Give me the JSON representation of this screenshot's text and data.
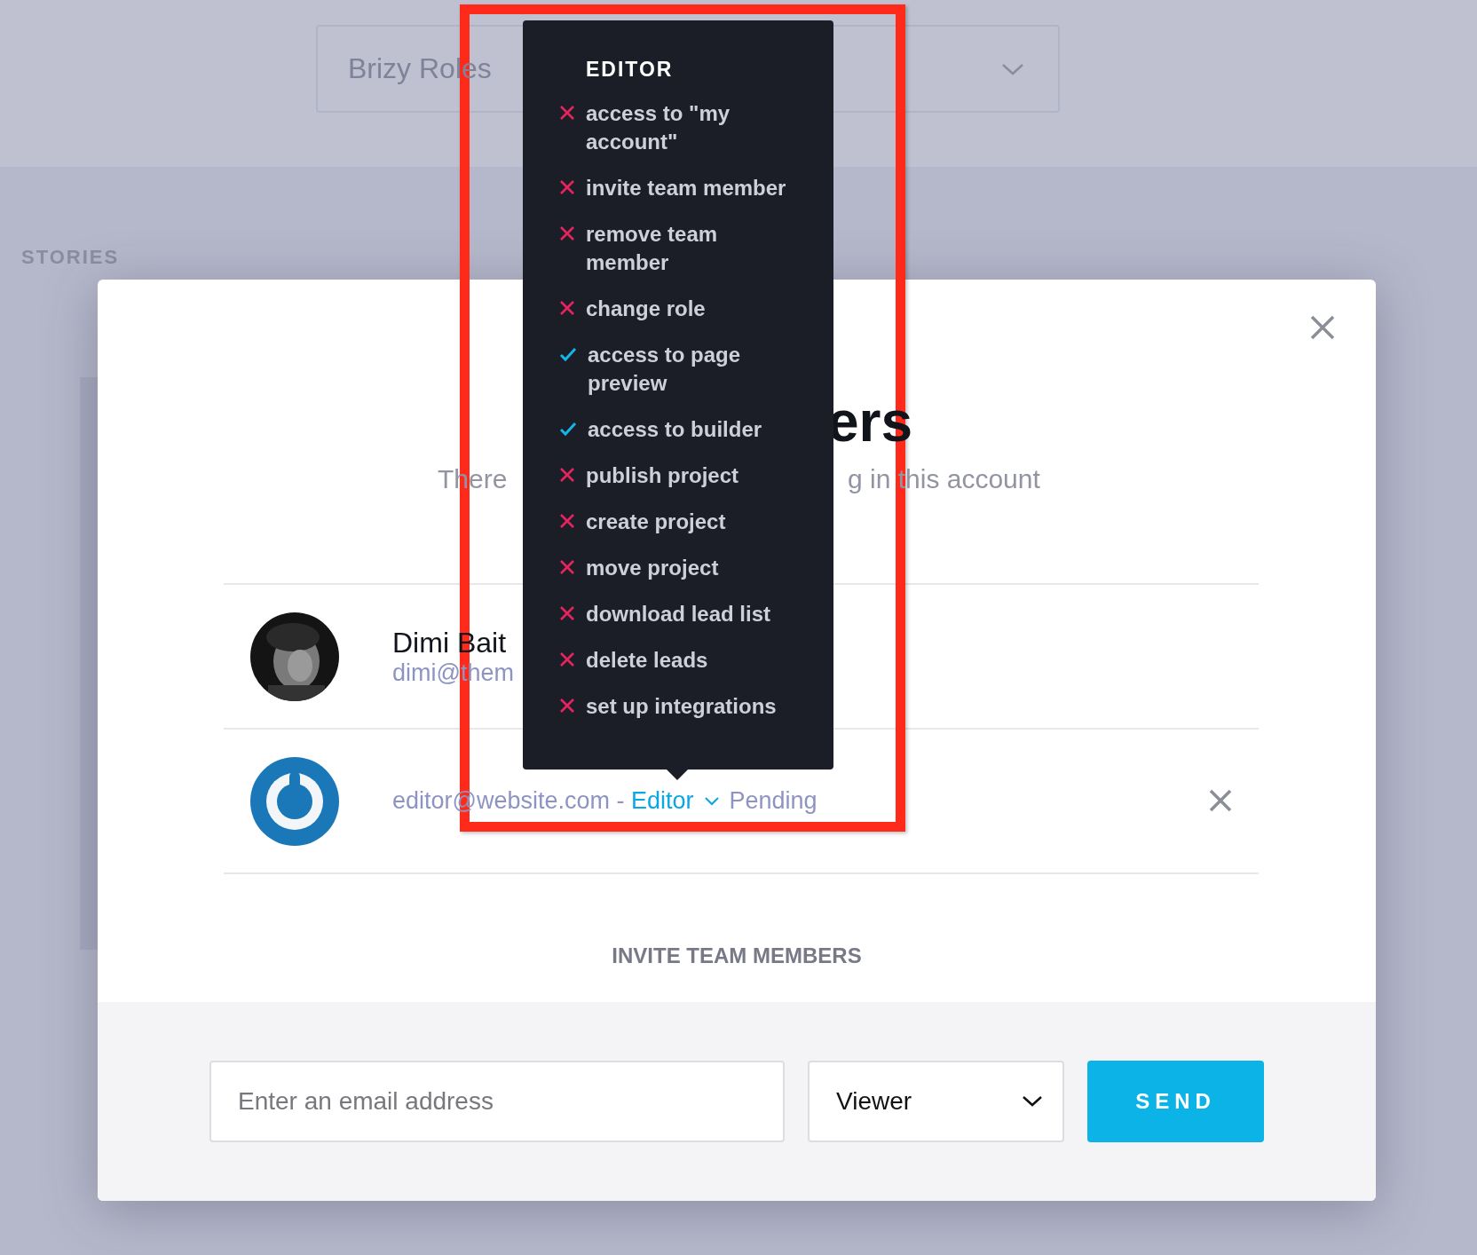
{
  "top_bar": {
    "roles_dropdown": {
      "value": "Brizy Roles"
    }
  },
  "section_label": "STORIES",
  "modal": {
    "title": "ers",
    "subtitle_left": "There",
    "subtitle_right": "g in this account",
    "members": [
      {
        "kind": "user",
        "name": "Dimi Bait",
        "email": "dimi@them"
      },
      {
        "kind": "invite",
        "email": "editor@website.com - ",
        "role": "Editor",
        "status": "Pending"
      }
    ],
    "invite_heading": "INVITE TEAM MEMBERS",
    "email_field": {
      "placeholder": "Enter an email address"
    },
    "role_select": {
      "value": "Viewer"
    },
    "send_button": "SEND"
  },
  "tooltip": {
    "title": "EDITOR",
    "items": [
      {
        "label": "access to \"my account\"",
        "allowed": false
      },
      {
        "label": "invite team member",
        "allowed": false
      },
      {
        "label": "remove team member",
        "allowed": false
      },
      {
        "label": "change role",
        "allowed": false
      },
      {
        "label": "access to page preview",
        "allowed": true
      },
      {
        "label": "access to builder",
        "allowed": true
      },
      {
        "label": "publish project",
        "allowed": false
      },
      {
        "label": "create project",
        "allowed": false
      },
      {
        "label": "move project",
        "allowed": false
      },
      {
        "label": "download lead list",
        "allowed": false
      },
      {
        "label": "delete leads",
        "allowed": false
      },
      {
        "label": "set up integrations",
        "allowed": false
      }
    ]
  }
}
